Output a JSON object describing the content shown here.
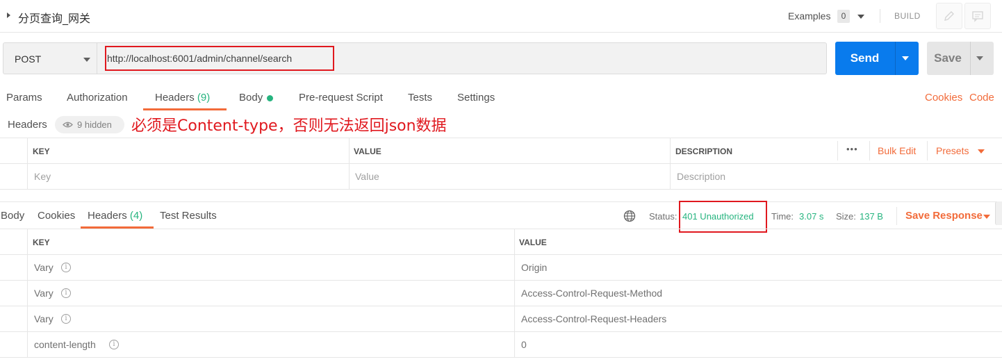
{
  "request": {
    "title": "分页查询_网关",
    "examples_label": "Examples",
    "examples_count": "0",
    "build_label": "BUILD",
    "method": "POST",
    "url": "http://localhost:6001/admin/channel/search",
    "send_label": "Send",
    "save_label": "Save"
  },
  "request_tabs": {
    "params": "Params",
    "authorization": "Authorization",
    "headers": "Headers",
    "headers_count": "(9)",
    "body": "Body",
    "prerequest": "Pre-request Script",
    "tests": "Tests",
    "settings": "Settings",
    "cookies": "Cookies",
    "code": "Code"
  },
  "headers_bar": {
    "label": "Headers",
    "hidden": "9 hidden",
    "annotation": "必须是Content-type，否则无法返回json数据"
  },
  "request_headers_table": {
    "col_key": "KEY",
    "col_value": "VALUE",
    "col_description": "DESCRIPTION",
    "more": "•••",
    "bulk_edit": "Bulk Edit",
    "presets": "Presets",
    "placeholder_key": "Key",
    "placeholder_value": "Value",
    "placeholder_description": "Description"
  },
  "response_tabs": {
    "body": "Body",
    "cookies": "Cookies",
    "headers": "Headers",
    "headers_count": "(4)",
    "test_results": "Test Results"
  },
  "response_meta": {
    "status_label": "Status:",
    "status_value": "401 Unauthorized",
    "time_label": "Time:",
    "time_value": "3.07 s",
    "size_label": "Size:",
    "size_value": "137 B",
    "save_response": "Save Response"
  },
  "response_headers": {
    "col_key": "KEY",
    "col_value": "VALUE",
    "rows": [
      {
        "key": "Vary",
        "value": "Origin"
      },
      {
        "key": "Vary",
        "value": "Access-Control-Request-Method"
      },
      {
        "key": "Vary",
        "value": "Access-Control-Request-Headers"
      },
      {
        "key": "content-length",
        "value": "0"
      }
    ]
  },
  "colors": {
    "accent_orange": "#f26b3a",
    "send_blue": "#097bed",
    "status_green": "#26b47f",
    "annotation_red": "#e0181e"
  }
}
